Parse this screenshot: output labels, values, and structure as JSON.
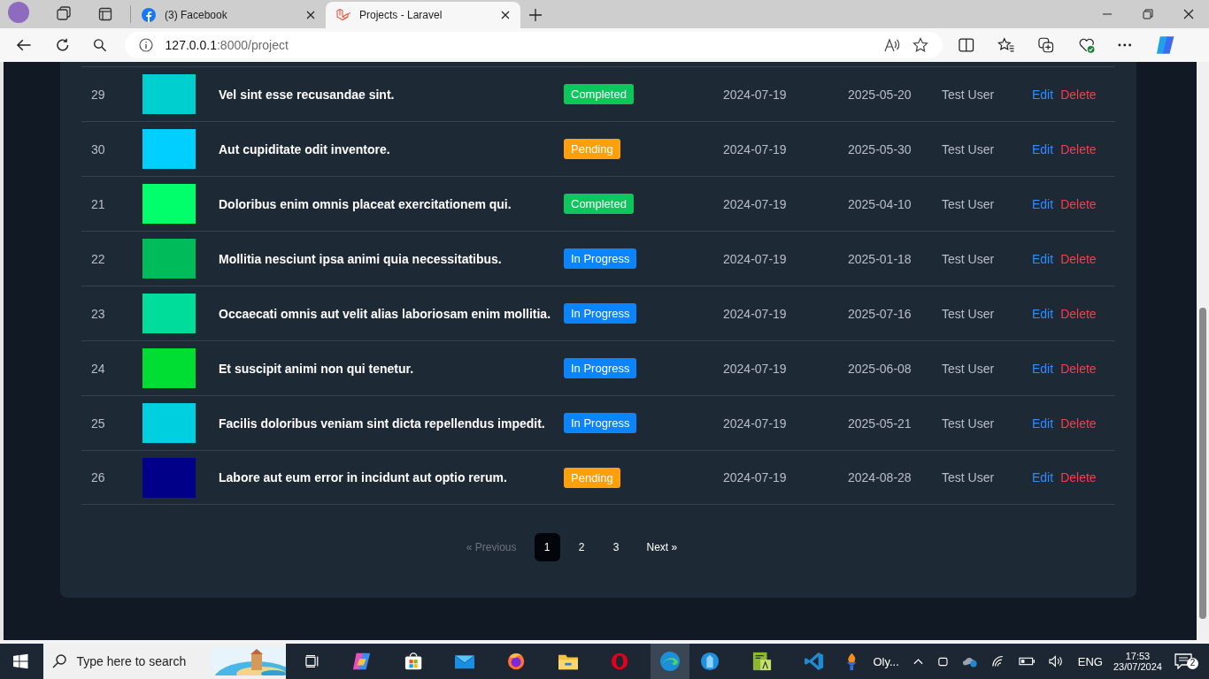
{
  "browser": {
    "tabs": [
      {
        "title": "(3) Facebook",
        "kind": "facebook",
        "selected": false
      },
      {
        "title": "Projects - Laravel",
        "kind": "laravel",
        "selected": true
      }
    ],
    "address": {
      "host": "127.0.0.1",
      "path": ":8000/project"
    }
  },
  "table": {
    "rows": [
      {
        "id": "29",
        "color": "#00cfcf",
        "title": "Vel sint esse recusandae sint.",
        "status": "Completed",
        "kind": "completed",
        "start": "2024-07-19",
        "end": "2025-05-20",
        "user": "Test User",
        "edit": "Edit",
        "delete": "Delete"
      },
      {
        "id": "30",
        "color": "#00cfff",
        "title": "Aut cupiditate odit inventore.",
        "status": "Pending",
        "kind": "pending",
        "start": "2024-07-19",
        "end": "2025-05-30",
        "user": "Test User",
        "edit": "Edit",
        "delete": "Delete"
      },
      {
        "id": "21",
        "color": "#00ff6a",
        "title": "Doloribus enim omnis placeat exercitationem qui.",
        "status": "Completed",
        "kind": "completed",
        "start": "2024-07-19",
        "end": "2025-04-10",
        "user": "Test User",
        "edit": "Edit",
        "delete": "Delete"
      },
      {
        "id": "22",
        "color": "#00bb5a",
        "title": "Mollitia nesciunt ipsa animi quia necessitatibus.",
        "status": "In Progress",
        "kind": "in_progress",
        "start": "2024-07-19",
        "end": "2025-01-18",
        "user": "Test User",
        "edit": "Edit",
        "delete": "Delete"
      },
      {
        "id": "23",
        "color": "#00dd9a",
        "title": "Occaecati omnis aut velit alias laboriosam enim mollitia.",
        "status": "In Progress",
        "kind": "in_progress",
        "start": "2024-07-19",
        "end": "2025-07-16",
        "user": "Test User",
        "edit": "Edit",
        "delete": "Delete"
      },
      {
        "id": "24",
        "color": "#00dd33",
        "title": "Et suscipit animi non qui tenetur.",
        "status": "In Progress",
        "kind": "in_progress",
        "start": "2024-07-19",
        "end": "2025-06-08",
        "user": "Test User",
        "edit": "Edit",
        "delete": "Delete"
      },
      {
        "id": "25",
        "color": "#00cfdf",
        "title": "Facilis doloribus veniam sint dicta repellendus impedit.",
        "status": "In Progress",
        "kind": "in_progress",
        "start": "2024-07-19",
        "end": "2025-05-21",
        "user": "Test User",
        "edit": "Edit",
        "delete": "Delete"
      },
      {
        "id": "26",
        "color": "#000088",
        "title": "Labore aut eum error in incidunt aut optio rerum.",
        "status": "Pending",
        "kind": "pending",
        "start": "2024-07-19",
        "end": "2024-08-28",
        "user": "Test User",
        "edit": "Edit",
        "delete": "Delete"
      }
    ]
  },
  "pagination": {
    "previous": "« Previous",
    "pages": [
      {
        "label": "1",
        "selected": true
      },
      {
        "label": "2",
        "selected": false
      },
      {
        "label": "3",
        "selected": false
      }
    ],
    "next": "Next »"
  },
  "taskbar": {
    "search_placeholder": "Type here to search",
    "app_label": "Oly...",
    "language": "ENG",
    "time": "17:53",
    "date": "23/07/2024",
    "notifications": "2"
  }
}
